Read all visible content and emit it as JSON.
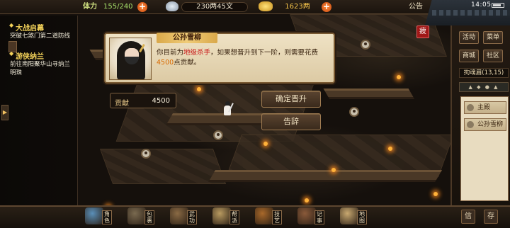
{
  "topbar": {
    "stamina_label": "体力",
    "stamina_value": "155/240",
    "silver_value": "230两45文",
    "gold_value": "1623两",
    "notice_label": "公告",
    "clock": "14:05"
  },
  "quests": [
    {
      "title": "大战启幕",
      "desc": "突破七煞门第二道防线"
    },
    {
      "title": "游侠纳兰",
      "desc": "前往南阳聚华山寻纳兰明珠"
    }
  ],
  "dialog": {
    "npc_name": "公孙雪柳",
    "text_before": "你目前为",
    "rank": "地级杀手",
    "text_middle": "，如果想晋升到下一阶，则需要花费",
    "cost": "4500",
    "text_after": "点贡献。"
  },
  "contribution": {
    "label": "贡献",
    "value": "4500"
  },
  "actions": {
    "promote": "确定晋升",
    "leave": "告辞"
  },
  "status_badge": "疲",
  "right_panel": {
    "buttons": [
      "活动",
      "菜单",
      "商城",
      "社区"
    ],
    "location": "拘魂眉(13,15)",
    "npc_list": [
      "主殿",
      "公孙雪柳"
    ]
  },
  "bottom_menu": [
    {
      "label": "角色",
      "color": "#5a8fb8"
    },
    {
      "label": "包裹",
      "color": "#7a6a50"
    },
    {
      "label": "武功",
      "color": "#8a6a44"
    },
    {
      "label": "帮派",
      "color": "#b89a60"
    },
    {
      "label": "技艺",
      "color": "#a8682a"
    },
    {
      "label": "记事",
      "color": "#8a5a3a"
    },
    {
      "label": "地图",
      "color": "#c8a870"
    }
  ],
  "bottom_right": [
    "信",
    "存"
  ]
}
